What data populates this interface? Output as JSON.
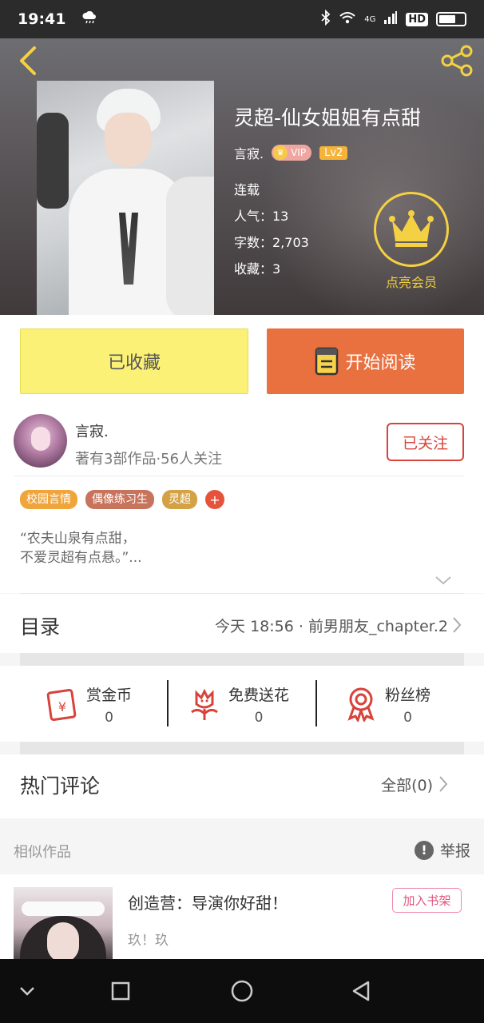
{
  "status_bar": {
    "time": "19:41",
    "network": "4G",
    "hd": "HD"
  },
  "book": {
    "title": "灵超-仙女姐姐有点甜",
    "author": "言寂.",
    "vip": "VIP",
    "level": "Lv2",
    "status": "连载",
    "popularity": "人气：13",
    "word_count": "字数：2,703",
    "favorites": "收藏：3"
  },
  "member": {
    "label": "点亮会员"
  },
  "actions": {
    "favorited_label": "已收藏",
    "read_label": "开始阅读"
  },
  "author_card": {
    "name": "言寂.",
    "stats": "著有3部作品·56人关注",
    "follow_label": "已关注"
  },
  "tags": [
    "校园言情",
    "偶像练习生",
    "灵超"
  ],
  "tag_add": "+",
  "description": {
    "line1": "“农夫山泉有点甜，",
    "line2": "不爱灵超有点悬。”..."
  },
  "catalog": {
    "title": "目录",
    "latest": "今天 18:56 · 前男朋友_chapter.2"
  },
  "stats": [
    {
      "label": "赏金币",
      "value": "0",
      "icon": "red-envelope-icon"
    },
    {
      "label": "免费送花",
      "value": "0",
      "icon": "flower-icon"
    },
    {
      "label": "粉丝榜",
      "value": "0",
      "icon": "ribbon-medal-icon"
    }
  ],
  "comments": {
    "title": "热门评论",
    "all_label": "全部(0)"
  },
  "similar": {
    "title": "相似作品",
    "report_label": "举报"
  },
  "work": {
    "title": "创造营：导演你好甜！",
    "author": "玖！玖",
    "shelf_label": "加入书架"
  },
  "colors": {
    "accent_orange": "#e9703f",
    "fav_yellow": "#fbf177",
    "follow_red": "#d8433a",
    "member_gold": "#f4d143"
  }
}
